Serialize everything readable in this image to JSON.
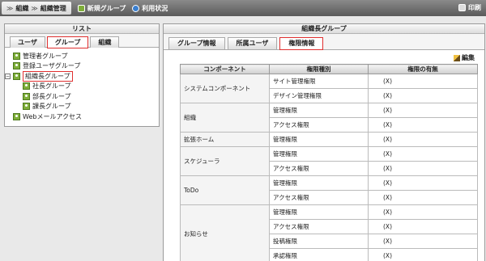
{
  "topbar": {
    "crumb1": "組織",
    "crumb2": "組織管理",
    "new_group": "新規グループ",
    "usage": "利用状況",
    "print": "印刷"
  },
  "left_panel": {
    "title": "リスト",
    "tabs": [
      "ユーザ",
      "グループ",
      "組織"
    ],
    "active_tab": "グループ",
    "tree": [
      {
        "label": "管理者グループ",
        "level": 0
      },
      {
        "label": "登録ユーザグループ",
        "level": 0
      },
      {
        "label": "組織長グループ",
        "level": 0,
        "selected": true,
        "expanded": true
      },
      {
        "label": "社長グループ",
        "level": 1
      },
      {
        "label": "部長グループ",
        "level": 1
      },
      {
        "label": "課長グループ",
        "level": 1
      },
      {
        "label": "Webメールアクセス",
        "level": 0
      }
    ],
    "expander_symbol": "−"
  },
  "right_panel": {
    "title": "組織長グループ",
    "tabs": [
      "グループ情報",
      "所属ユーザ",
      "権限情報"
    ],
    "active_tab": "権限情報",
    "edit_label": "編集",
    "table": {
      "headers": [
        "コンポーネント",
        "権限種別",
        "権限の有無"
      ],
      "groups": [
        {
          "component": "システムコンポーネント",
          "rows": [
            [
              "サイト管理権限",
              "(X)"
            ],
            [
              "デザイン管理権限",
              "(X)"
            ]
          ]
        },
        {
          "component": "組織",
          "rows": [
            [
              "管理権限",
              "(X)"
            ],
            [
              "アクセス権限",
              "(X)"
            ]
          ]
        },
        {
          "component": "拡張ホーム",
          "rows": [
            [
              "管理権限",
              "(X)"
            ]
          ]
        },
        {
          "component": "スケジューラ",
          "rows": [
            [
              "管理権限",
              "(X)"
            ],
            [
              "アクセス権限",
              "(X)"
            ]
          ]
        },
        {
          "component": "ToDo",
          "rows": [
            [
              "管理権限",
              "(X)"
            ],
            [
              "アクセス権限",
              "(X)"
            ]
          ]
        },
        {
          "component": "お知らせ",
          "rows": [
            [
              "管理権限",
              "(X)"
            ],
            [
              "アクセス権限",
              "(X)"
            ],
            [
              "投稿権限",
              "(X)"
            ],
            [
              "承認権限",
              "(X)"
            ]
          ]
        }
      ]
    }
  },
  "colors": {
    "highlight": "#e03030",
    "group_icon": "#7fae3a",
    "topbar": "#6a6a6a"
  }
}
